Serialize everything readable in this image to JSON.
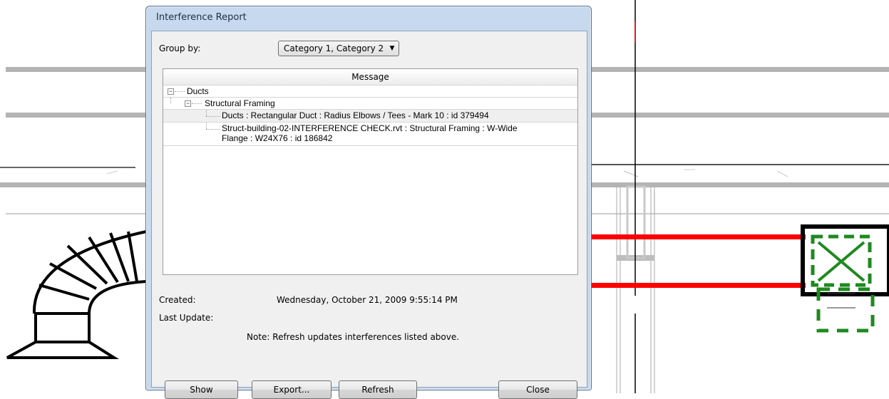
{
  "dialog": {
    "title": "Interference Report",
    "group_by_label": "Group by:",
    "group_by_value": "Category 1, Category 2",
    "dropdown_icon": "chevron-down-icon",
    "column_header": "Message",
    "tree": {
      "node1": {
        "label": "Ducts",
        "expanded": true
      },
      "node2": {
        "label": "Structural Framing",
        "expanded": true
      },
      "item1": "Ducts : Rectangular Duct : Radius Elbows / Tees - Mark 10 : id 379494",
      "item2_line1": "Struct-building-02-INTERFERENCE CHECK.rvt : Structural Framing : W-Wide",
      "item2_line2": "Flange : W24X76 : id 186842",
      "toggle_symbol": "⊟"
    },
    "created_label": "Created:",
    "created_value": "Wednesday, October 21, 2009 9:55:14 PM",
    "last_update_label": "Last Update:",
    "note": "Note: Refresh updates interferences listed above.",
    "buttons": {
      "show": "Show",
      "export": "Export...",
      "refresh": "Refresh",
      "close": "Close"
    }
  },
  "colors": {
    "duct_highlight": "#ff0000",
    "element_highlight": "#1e8a1e",
    "wall_gray": "#b4b4b4"
  }
}
